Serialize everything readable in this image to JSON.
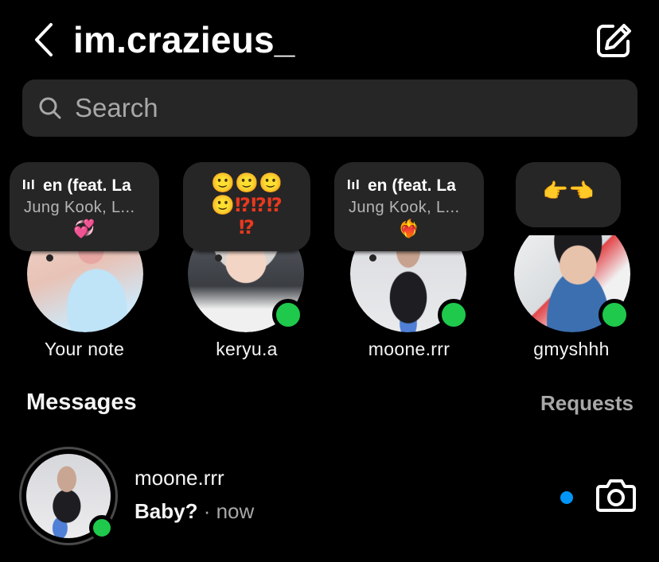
{
  "header": {
    "title": "im.crazieus_",
    "back_icon": "chevron-left-icon",
    "compose_icon": "compose-edit-icon"
  },
  "search": {
    "placeholder": "Search",
    "icon": "search-icon"
  },
  "notes": [
    {
      "username": "Your note",
      "note_song": "en (feat. La",
      "note_artist": "Jung Kook, L...",
      "note_emoji": "💞",
      "online": false
    },
    {
      "username": "keryu.a",
      "note_text_line1": "🙂🙂🙂",
      "note_text_line2": "🙂⁉⁉⁉",
      "note_text_line3": "⁉",
      "online": true
    },
    {
      "username": "moone.rrr",
      "note_song": "en (feat. La",
      "note_artist": "Jung Kook, L...",
      "note_emoji": "❤‍🔥",
      "online": true
    },
    {
      "username": "gmyshhh",
      "note_text": "👉👈",
      "online": true
    }
  ],
  "messages": {
    "title": "Messages",
    "requests_label": "Requests"
  },
  "threads": [
    {
      "username": "moone.rrr",
      "preview": "Baby?",
      "time": " · now",
      "unread": true,
      "online": true,
      "camera_icon": "camera-icon"
    }
  ],
  "colors": {
    "background": "#000000",
    "surface": "#262626",
    "online": "#1fc94b",
    "unread": "#0095f6",
    "muted": "#a8a8a8"
  }
}
